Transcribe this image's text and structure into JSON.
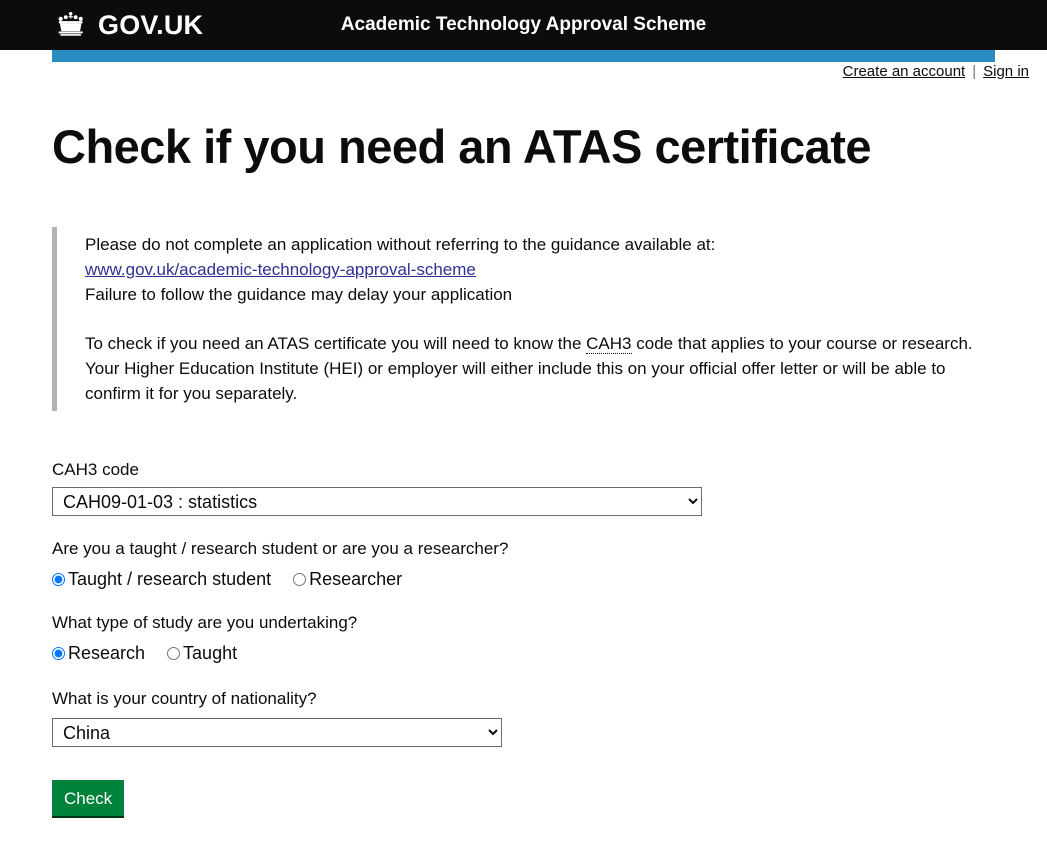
{
  "header": {
    "brand_name": "GOV.UK",
    "crown_icon": "crown-icon",
    "service_title": "Academic Technology Approval Scheme",
    "bar_color": "#2b8cc4",
    "background_color": "#0b0c0c"
  },
  "account_bar": {
    "create_account_label": "Create an account",
    "separator": "|",
    "sign_in_label": "Sign in"
  },
  "main": {
    "page_title": "Check if you need an ATAS certificate"
  },
  "inset": {
    "line1": "Please do not complete an application without referring to the guidance available at:",
    "link_text": "www.gov.uk/academic-technology-approval-scheme",
    "link_color": "#2e3192",
    "line3": "Failure to follow the guidance may delay your application",
    "paragraph2_part1": "To check if you need an ATAS certificate you will need to know the ",
    "paragraph2_abbr": "CAH3",
    "paragraph2_part2": " code that applies to your course or research. Your Higher Education Institute (HEI) or employer will either include this on your official offer letter or will be able to confirm it for you separately.",
    "border_color": "#b1b4b6"
  },
  "form": {
    "cah3": {
      "label": "CAH3 code",
      "selected_value": "CAH09-01-03 : statistics"
    },
    "student_type": {
      "question": "Are you a taught / research student or are you a researcher?",
      "options": [
        {
          "label": "Taught / research student",
          "checked": true
        },
        {
          "label": "Researcher",
          "checked": false
        }
      ]
    },
    "study_type": {
      "question": "What type of study are you undertaking?",
      "options": [
        {
          "label": "Research",
          "checked": true
        },
        {
          "label": "Taught",
          "checked": false
        }
      ]
    },
    "nationality": {
      "question": "What is your country of nationality?",
      "selected_value": "China"
    },
    "submit": {
      "label": "Check",
      "background_color": "#00823b",
      "shadow_color": "#003618"
    }
  }
}
